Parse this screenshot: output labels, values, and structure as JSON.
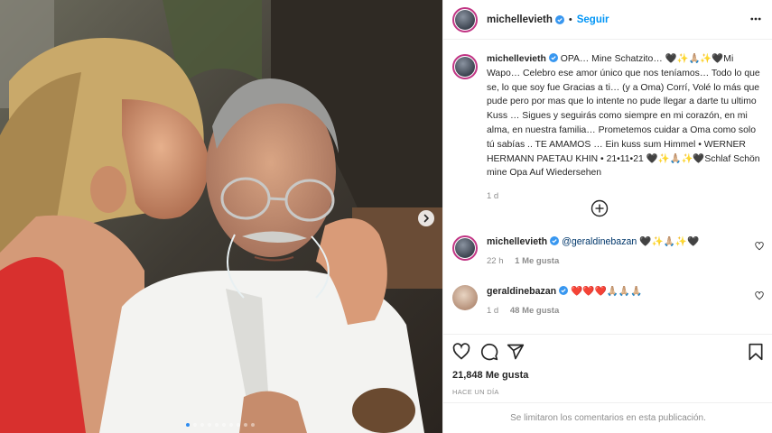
{
  "post": {
    "username": "michellevieth",
    "separator": "•",
    "follow_label": "Seguir",
    "caption": "OPA… Mine Schatzito… 🖤✨🙏🏼✨🖤Mi Wapo… Celebro ese amor único que nos teníamos… Todo lo que se, lo que soy fue Gracias a ti… (y a Oma) Corrí, Volé lo más que pude pero por mas que lo intente no pude llegar a darte tu ultimo Kuss … Sigues y seguirás como siempre en mi corazón, en mi alma, en nuestra familia… Prometemos cuidar a Oma como solo tú sabías .. TE AMAMOS … Ein kuss sum Himmel • WERNER HERMANN PAETAU KHIN • 21•11•21 🖤✨🙏🏼✨🖤Schlaf Schön mine Opa Auf Wiedersehen",
    "caption_age": "1 d",
    "likes": "21,848 Me gusta",
    "time_ago": "HACE UN DÍA",
    "comments_disabled": "Se limitaron los comentarios en esta publicación."
  },
  "comments": [
    {
      "username": "michellevieth",
      "mention": "@geraldinebazan",
      "text": "🖤✨🙏🏼✨🖤",
      "age": "22 h",
      "likes": "1 Me gusta"
    },
    {
      "username": "geraldinebazan",
      "mention": "",
      "text": "❤️❤️❤️🙏🏼🙏🏼🙏🏼",
      "age": "1 d",
      "likes": "48 Me gusta"
    }
  ],
  "carousel": {
    "slides": 10,
    "active_index": 0
  },
  "icons": {
    "verified": "verified-badge-icon",
    "more": "more-options-icon",
    "next": "chevron-right-icon",
    "load_more": "plus-circle-icon",
    "like": "heart-icon",
    "comment": "comment-bubble-icon",
    "share": "paper-plane-icon",
    "save": "bookmark-icon"
  },
  "colors": {
    "accent": "#0095f6",
    "verified": "#3897f0",
    "secondary": "#8e8e8e",
    "text": "#262626"
  }
}
